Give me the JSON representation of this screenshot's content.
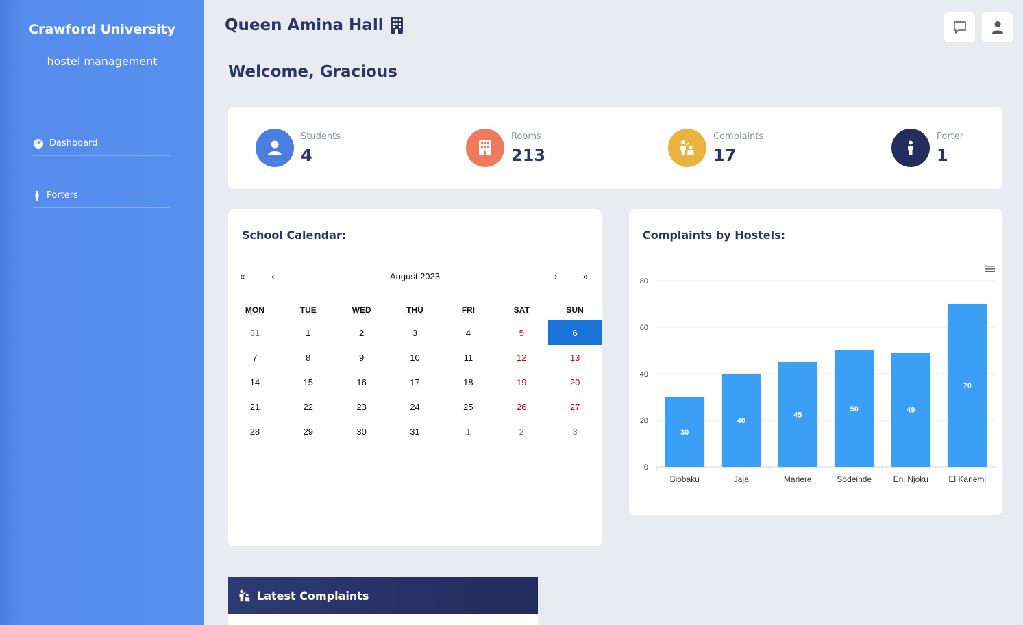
{
  "sidebar": {
    "brand_title": "Crawford University",
    "brand_subtitle": "hostel management",
    "items": [
      {
        "label": "Dashboard",
        "icon": "dashboard-icon"
      },
      {
        "label": "Porters",
        "icon": "person-icon"
      }
    ]
  },
  "header": {
    "hall_title": "Queen Amina Hall",
    "hall_icon": "building-icon",
    "buttons": [
      "chat-icon",
      "user-icon"
    ]
  },
  "welcome": "Welcome, Gracious",
  "stats": [
    {
      "label": "Students",
      "value": "4",
      "color": "#4a7fe0",
      "icon": "user-icon"
    },
    {
      "label": "Rooms",
      "value": "213",
      "color": "#f07a5c",
      "icon": "building-icon"
    },
    {
      "label": "Complaints",
      "value": "17",
      "color": "#eab23f",
      "icon": "complaints-icon"
    },
    {
      "label": "Porter",
      "value": "1",
      "color": "#252d5c",
      "icon": "person-icon"
    }
  ],
  "calendar": {
    "title": "School Calendar:",
    "month_label": "August 2023",
    "nav": {
      "prev_year": "«",
      "prev_month": "‹",
      "next_month": "›",
      "next_year": "»"
    },
    "weekdays": [
      "MON",
      "TUE",
      "WED",
      "THU",
      "FRI",
      "SAT",
      "SUN"
    ],
    "weeks": [
      [
        "31",
        "1",
        "2",
        "3",
        "4",
        "5",
        "6"
      ],
      [
        "7",
        "8",
        "9",
        "10",
        "11",
        "12",
        "13"
      ],
      [
        "14",
        "15",
        "16",
        "17",
        "18",
        "19",
        "20"
      ],
      [
        "21",
        "22",
        "23",
        "24",
        "25",
        "26",
        "27"
      ],
      [
        "28",
        "29",
        "30",
        "31",
        "1",
        "2",
        "3"
      ]
    ],
    "today": "6"
  },
  "complaints_chart": {
    "title": "Complaints by Hostels:",
    "menu_icon": "hamburger-menu-icon",
    "bar_color": "#3b9ff5"
  },
  "chart_data": {
    "type": "bar",
    "categories": [
      "Biobaku",
      "Jaja",
      "Mariere",
      "Sodeinde",
      "Eni Njoku",
      "El Kanemi"
    ],
    "values": [
      30,
      40,
      45,
      50,
      49,
      70
    ],
    "title": "Complaints by Hostels:",
    "xlabel": "",
    "ylabel": "",
    "ylim": [
      0,
      80
    ],
    "yticks": [
      0,
      20,
      40,
      60,
      80
    ],
    "grid": true,
    "data_labels": true
  },
  "latest_complaints": {
    "title": "Latest Complaints",
    "icon": "complaints-icon"
  }
}
